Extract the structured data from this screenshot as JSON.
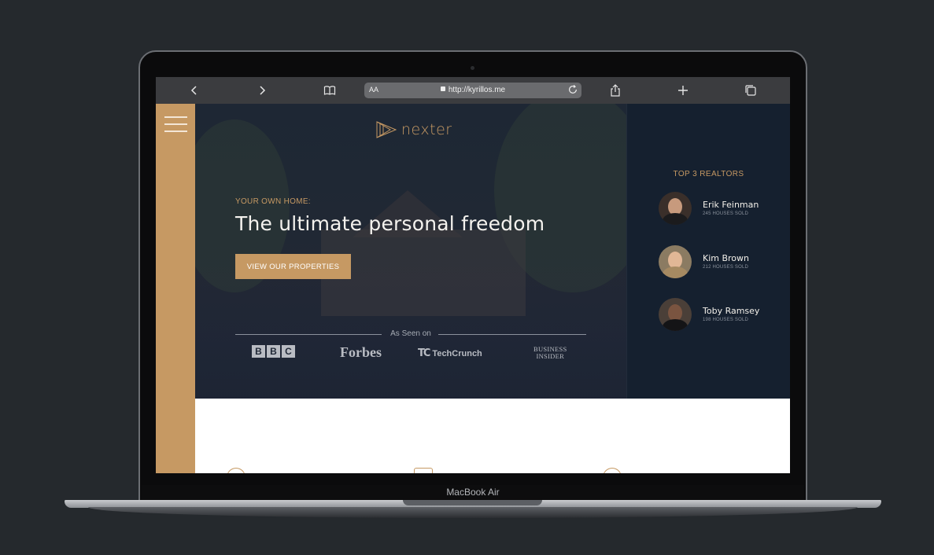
{
  "browser": {
    "address_text_size": "AA",
    "url": "http://kyrillos.me"
  },
  "brand": {
    "name": "nexter",
    "accent": "#c69963",
    "dark": "#1a2232"
  },
  "hero": {
    "subheading": "YOUR OWN HOME:",
    "heading": "The ultimate personal freedom",
    "cta_label": "VIEW OUR PROPERTIES",
    "as_seen_on": "As Seen on",
    "press": {
      "bbc": [
        "B",
        "B",
        "C"
      ],
      "forbes": "Forbes",
      "techcrunch_mark": "TC",
      "techcrunch": "TechCrunch",
      "business_insider_line1": "BUSINESS",
      "business_insider_line2": "INSIDER"
    }
  },
  "realtors": {
    "title": "TOP 3 REALTORS",
    "items": [
      {
        "name": "Erik Feinman",
        "sold": "245 HOUSES SOLD"
      },
      {
        "name": "Kim Brown",
        "sold": "212 HOUSES SOLD"
      },
      {
        "name": "Toby Ramsey",
        "sold": "198 HOUSES SOLD"
      }
    ]
  },
  "device": {
    "model": "MacBook Air"
  },
  "icons": [
    "chevron-left-icon",
    "chevron-right-icon",
    "book-icon",
    "lock-icon",
    "reload-icon",
    "share-icon",
    "plus-icon",
    "tabs-icon",
    "hamburger-icon"
  ]
}
